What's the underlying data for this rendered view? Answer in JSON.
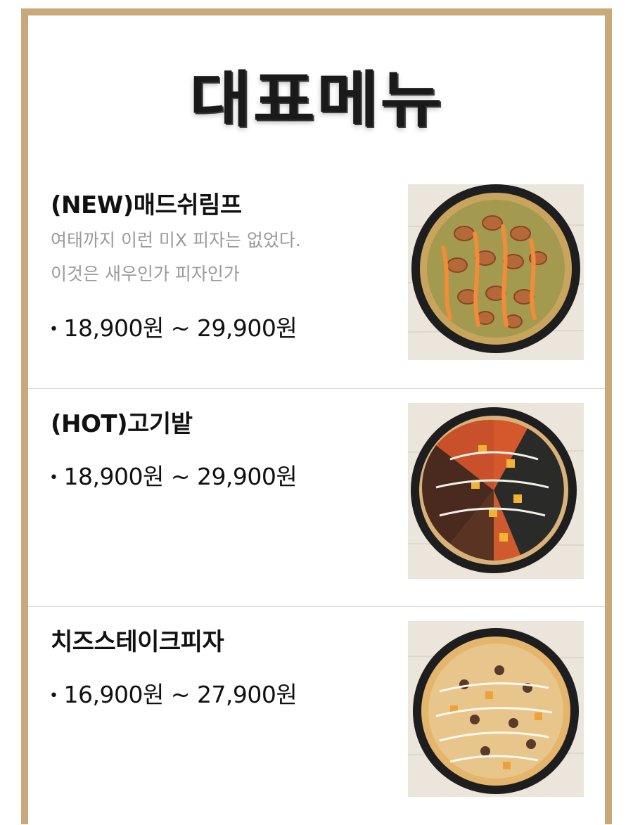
{
  "header": {
    "title": "대표메뉴"
  },
  "colors": {
    "frame": "#c9a87a",
    "divider": "#d8d8d8",
    "desc": "#9a9a9a"
  },
  "menu": [
    {
      "name": "(NEW)매드쉬림프",
      "desc_line1": "여태까지 이런 미X 피자는 없었다.",
      "desc_line2": "이것은 새우인가 피자인가",
      "price": "18,900원 ~ 29,900원",
      "image": "shrimp-pizza-photo"
    },
    {
      "name": "(HOT)고기밭",
      "price": "18,900원 ~ 29,900원",
      "image": "meat-pizza-photo"
    },
    {
      "name": "치즈스테이크피자",
      "price": "16,900원 ~ 27,900원",
      "image": "cheese-steak-pizza-photo"
    }
  ]
}
